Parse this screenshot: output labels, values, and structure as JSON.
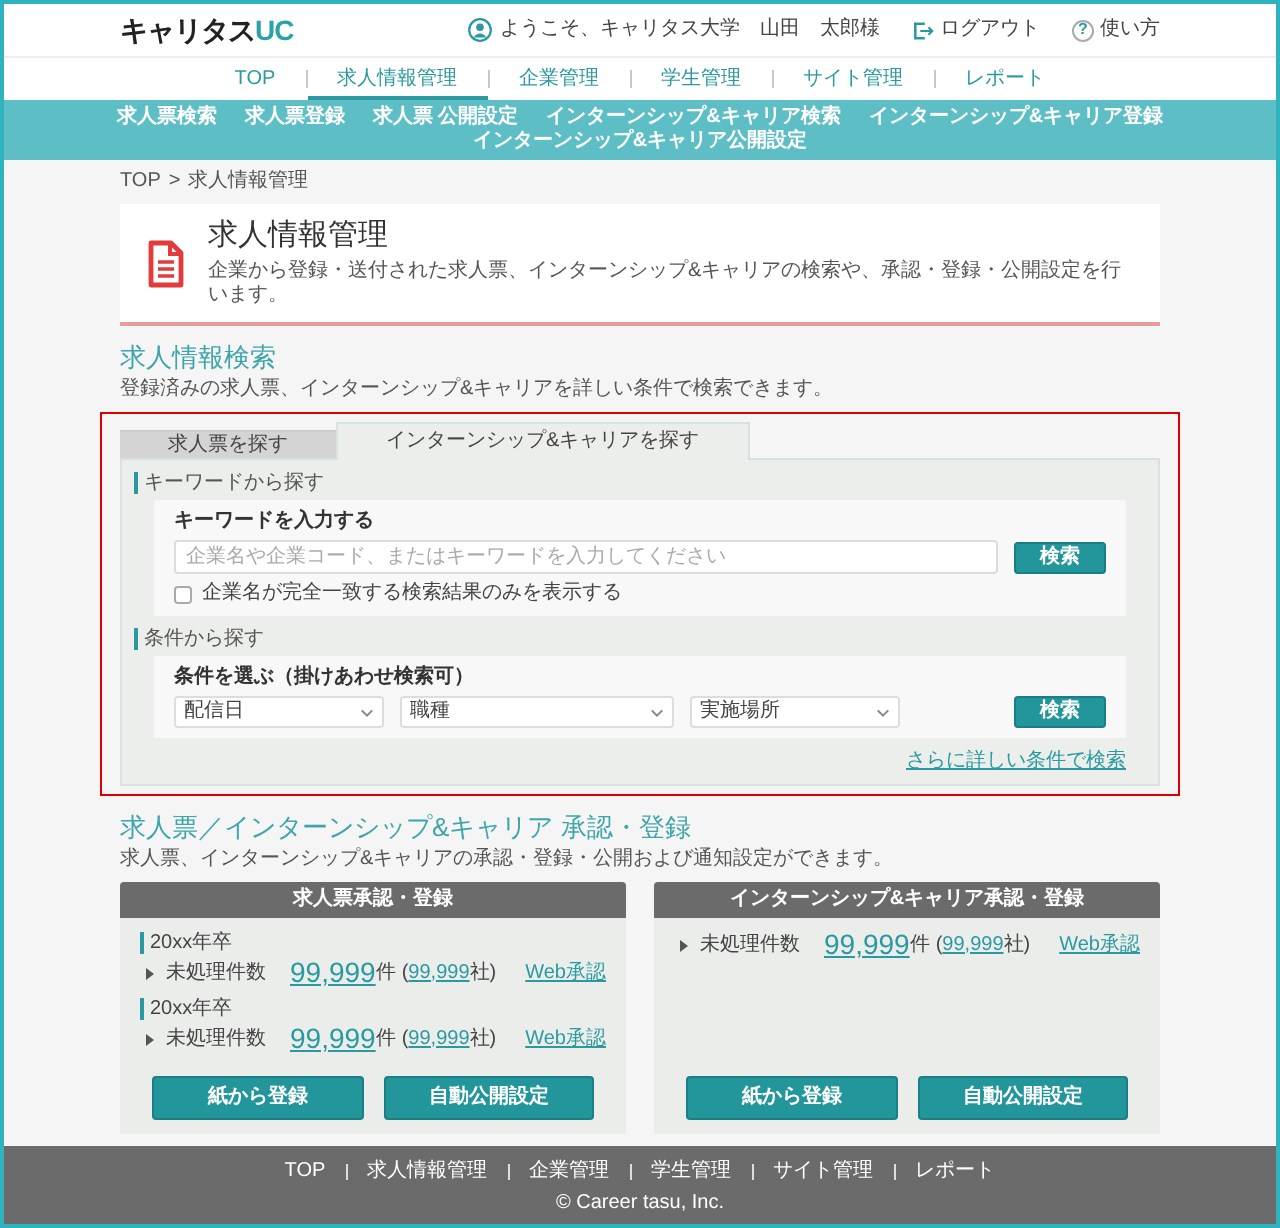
{
  "header": {
    "logo": {
      "text": "キャリタス",
      "accent": "UC"
    },
    "welcome": "ようこそ、キャリタス大学　山田　太郎様",
    "logout": "ログアウト",
    "help": {
      "icon": "?",
      "label": "使い方"
    }
  },
  "nav": [
    {
      "label": "TOP",
      "selected": false
    },
    {
      "label": "求人情報管理",
      "selected": true
    },
    {
      "label": "企業管理",
      "selected": false
    },
    {
      "label": "学生管理",
      "selected": false
    },
    {
      "label": "サイト管理",
      "selected": false
    },
    {
      "label": "レポート",
      "selected": false
    }
  ],
  "subnav": [
    "求人票検索",
    "求人票登録",
    "求人票 公開設定",
    "インターンシップ&キャリア検索",
    "インターンシップ&キャリア登録",
    "インターンシップ&キャリア公開設定"
  ],
  "breadcrumb": {
    "items": [
      "TOP",
      "求人情報管理"
    ],
    "separator": ">"
  },
  "page_header": {
    "title": "求人情報管理",
    "description": "企業から登録・送付された求人票、インターンシップ&キャリアの検索や、承認・登録・公開設定を行います。"
  },
  "search": {
    "title": "求人情報検索",
    "description": "登録済みの求人票、インターンシップ&キャリアを詳しい条件で検索できます。",
    "highlighted": true,
    "tabs": [
      {
        "label": "求人票を探す",
        "selected": false
      },
      {
        "label": "インターンシップ&キャリアを探す",
        "selected": true
      }
    ],
    "keyword": {
      "heading": "キーワードから探す",
      "label": "キーワードを入力する",
      "placeholder": "企業名や企業コード、またはキーワードを入力してください",
      "button": "検索",
      "checkbox": {
        "label": "企業名が完全一致する検索結果のみを表示する",
        "checked": false
      }
    },
    "conditions": {
      "heading": "条件から探す",
      "label": "条件を選ぶ（掛けあわせ検索可）",
      "selects": [
        {
          "value": "配信日"
        },
        {
          "value": "職種"
        },
        {
          "value": "実施場所"
        }
      ],
      "button": "検索"
    },
    "more_link": "さらに詳しい条件で検索"
  },
  "approval": {
    "title": "求人票／インターンシップ&キャリア 承認・登録",
    "description": "求人票、インターンシップ&キャリアの承認・登録・公開および通知設定ができます。",
    "cards": [
      {
        "title": "求人票承認・登録",
        "groups": [
          {
            "year": "20xx年卒",
            "rows": [
              {
                "label": "未処理件数",
                "count": "99,999",
                "count_unit": "件",
                "open": "(",
                "companies": "99,999",
                "companies_unit": "社)",
                "link": "Web承認"
              }
            ]
          },
          {
            "year": "20xx年卒",
            "rows": [
              {
                "label": "未処理件数",
                "count": "99,999",
                "count_unit": "件",
                "open": "(",
                "companies": "99,999",
                "companies_unit": "社)",
                "link": "Web承認"
              }
            ]
          }
        ],
        "buttons": [
          "紙から登録",
          "自動公開設定"
        ]
      },
      {
        "title": "インターンシップ&キャリア承認・登録",
        "groups": [
          {
            "rows": [
              {
                "label": "未処理件数",
                "count": "99,999",
                "count_unit": "件",
                "open": "(",
                "companies": "99,999",
                "companies_unit": "社)",
                "link": "Web承認"
              }
            ]
          }
        ],
        "buttons": [
          "紙から登録",
          "自動公開設定"
        ]
      }
    ]
  },
  "footer": {
    "links": [
      "TOP",
      "求人情報管理",
      "企業管理",
      "学生管理",
      "サイト管理",
      "レポート"
    ],
    "copyright": "© Career tasu, Inc."
  }
}
